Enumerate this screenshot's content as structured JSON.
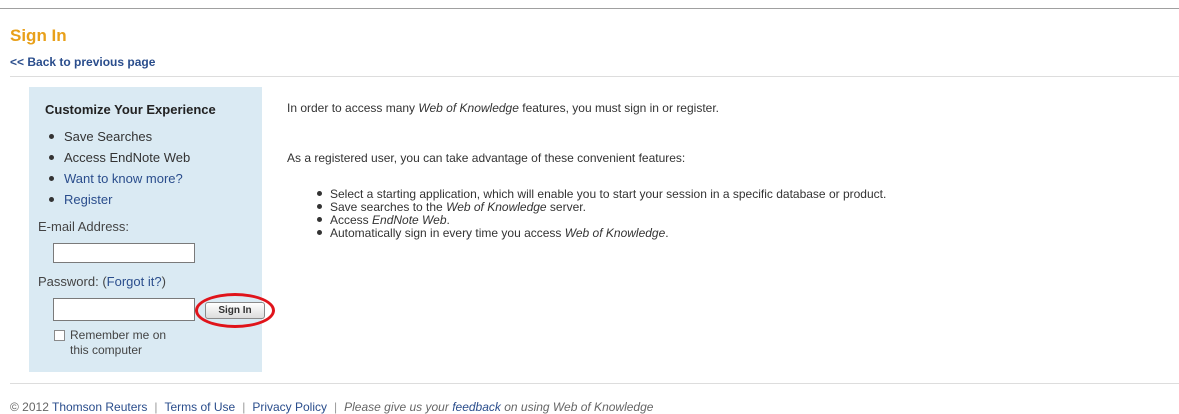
{
  "header": {
    "title": "Sign In",
    "back_link": "<< Back to previous page"
  },
  "sidebar": {
    "heading": "Customize Your Experience",
    "items": [
      {
        "label": "Save Searches",
        "link": false
      },
      {
        "label": "Access EndNote Web",
        "link": false
      },
      {
        "label": "Want to know more?",
        "link": true
      },
      {
        "label": "Register",
        "link": true
      }
    ],
    "email_label": "E-mail Address:",
    "email_value": "",
    "password_label": "Password:",
    "forgot_open": " (",
    "forgot_link": "Forgot it?",
    "forgot_close": ")",
    "password_value": "",
    "sign_in_button": "Sign In",
    "remember_label": "Remember me on this computer",
    "remember_checked": false
  },
  "main": {
    "intro_before": "In order to access many ",
    "intro_em": "Web of Knowledge",
    "intro_after": " features, you must sign in or register.",
    "advantage": "As a registered user, you can take advantage of these convenient features:",
    "benefits": [
      {
        "before": "Select a starting application, which will enable you to start your session in a specific database or product.",
        "em": "",
        "after": ""
      },
      {
        "before": "Save searches to the ",
        "em": "Web of Knowledge",
        "after": " server."
      },
      {
        "before": "Access ",
        "em": "EndNote Web",
        "after": "."
      },
      {
        "before": "Automatically sign in every time you access ",
        "em": "Web of Knowledge",
        "after": "."
      }
    ]
  },
  "footer": {
    "copyright": "© 2012 ",
    "company_link": "Thomson Reuters",
    "terms_link": "Terms of Use",
    "privacy_link": "Privacy Policy",
    "feedback_before": "Please give us your ",
    "feedback_link": "feedback",
    "feedback_after": " on using Web of Knowledge",
    "separator": "|"
  },
  "colors": {
    "title": "#e8a01a",
    "link": "#2a4d8c",
    "sidebar_bg": "#daeaf3",
    "highlight_ring": "#e0141b"
  }
}
